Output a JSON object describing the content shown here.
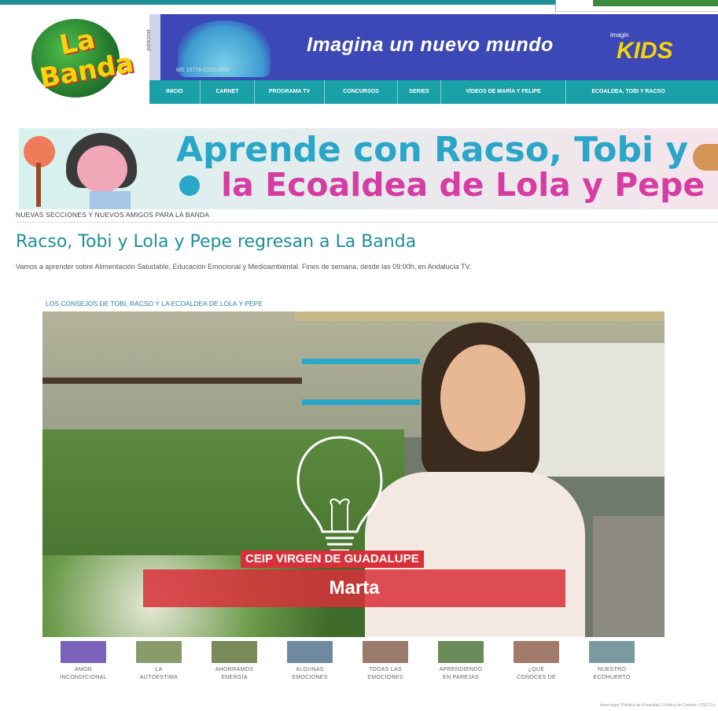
{
  "site": {
    "logo_text_line1": "La",
    "logo_text_line2": "Banda"
  },
  "ad_banner": {
    "side_label": "publicidad",
    "small_print": "MS 10778-0229-2003",
    "tagline": "Imagina un nuevo mundo",
    "brand_small": "imagin",
    "brand_big": "KIDS"
  },
  "menu": {
    "items": [
      "INICIO",
      "CARNET",
      "PROGRAMA TV",
      "CONCURSOS",
      "SERIES",
      "VÍDEOS DE MARÍA Y FELIPE",
      "ECOALDEA, TOBI Y RACSO"
    ]
  },
  "promo": {
    "line1": "Aprende con Racso, Tobi y",
    "line2": "la Ecoaldea de Lola y Pepe"
  },
  "article": {
    "kicker": "NUEVAS SECCIONES Y NUEVOS AMIGOS PARA LA BANDA",
    "headline": "Racso, Tobi y Lola y Pepe regresan a La Banda",
    "dek": "Vamos a aprender sobre Alimentación Saludable, Educación Emocional y Medioambiental. Fines de semana, desde las 09:00h, en Andalucía TV."
  },
  "video": {
    "section_label": "LOS CONSEJOS DE TOBI, RACSO Y LA ECOALDEA DE LOLA Y PEPE",
    "caption_school": "CEIP VIRGEN DE GUADALUPE",
    "caption_name": "Marta"
  },
  "thumbnails": [
    {
      "label_1": "AMOR",
      "label_2": "INCONDICIONAL",
      "color": "#7a63b8"
    },
    {
      "label_1": "LA",
      "label_2": "AUTOESTIMA",
      "color": "#8a9a6a"
    },
    {
      "label_1": "AHORRAMOS",
      "label_2": "ENERGÍA",
      "color": "#7a8a5a"
    },
    {
      "label_1": "ALGUNAS",
      "label_2": "EMOCIONES",
      "color": "#6f8aa0"
    },
    {
      "label_1": "TODAS LAS",
      "label_2": "EMOCIONES",
      "color": "#9a7a6a"
    },
    {
      "label_1": "APRENDIENDO",
      "label_2": "EN PAREJAS",
      "color": "#6a8a5a"
    },
    {
      "label_1": "¿QUÉ",
      "label_2": "CONOCES DE",
      "color": "#a07a6a"
    },
    {
      "label_1": "NUESTRO",
      "label_2": "ECOHUERTO",
      "color": "#7a9aa0"
    }
  ],
  "footer": {
    "links": "Aviso legal | Política de Privacidad | Política de Cookies | 2022 Ca"
  },
  "colors": {
    "teal": "#1e8f99",
    "menu_bg": "#1aa0a7",
    "banner_bg": "#3b48b5",
    "caption_red": "#d8303a"
  }
}
